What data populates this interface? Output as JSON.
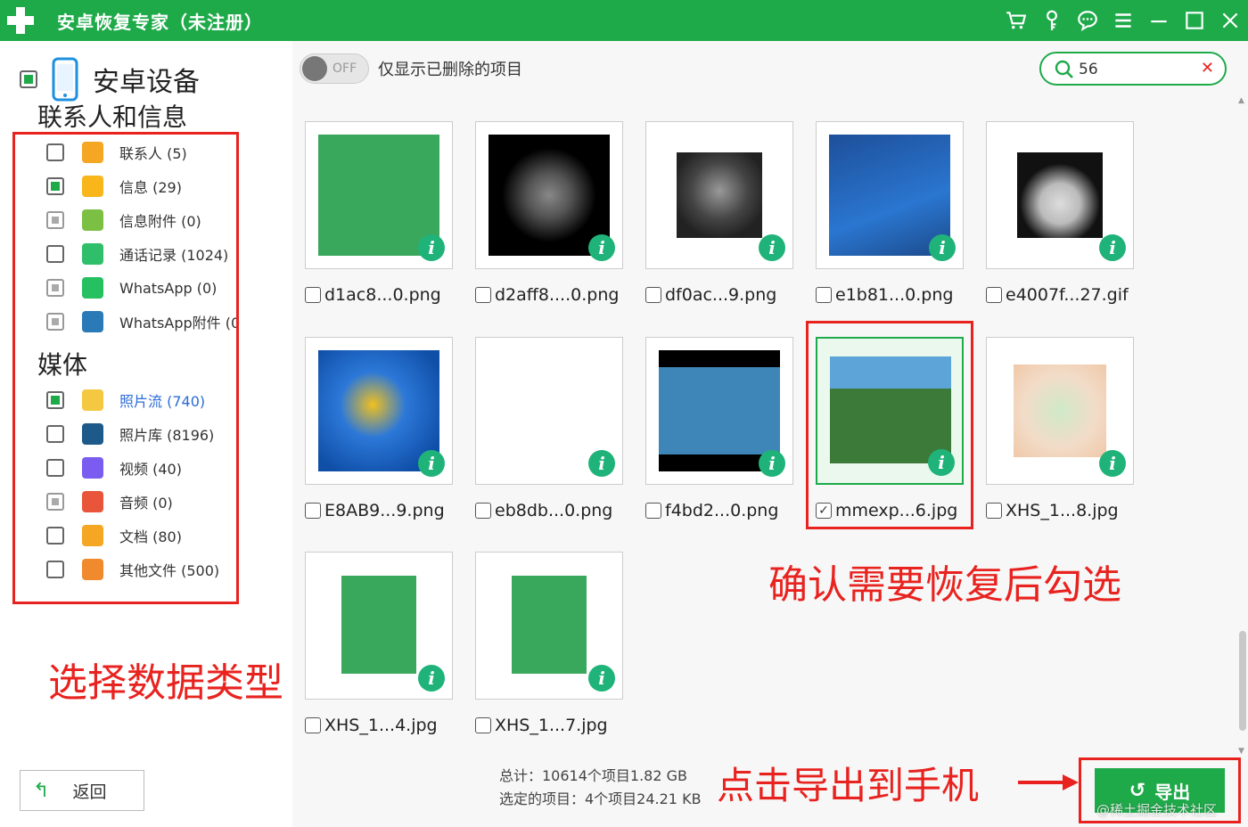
{
  "window": {
    "title": "安卓恢复专家（未注册）",
    "icons": [
      "cart-icon",
      "key-icon",
      "chat-icon",
      "menu-icon",
      "minimize-icon",
      "maximize-icon",
      "close-icon"
    ]
  },
  "sidebar": {
    "device_title": "安卓设备",
    "section_contacts": "联系人和信息",
    "section_media": "媒体",
    "contacts_items": [
      {
        "label": "联系人 (5)",
        "icon": "contact-icon",
        "color": "#f5a623",
        "state": "unchecked"
      },
      {
        "label": "信息 (29)",
        "icon": "message-icon",
        "color": "#f8b61b",
        "state": "checked"
      },
      {
        "label": "信息附件 (0)",
        "icon": "attachment-icon",
        "color": "#7bc043",
        "state": "partial"
      },
      {
        "label": "通话记录 (1024)",
        "icon": "phone-icon",
        "color": "#2fbf6a",
        "state": "unchecked"
      },
      {
        "label": "WhatsApp (0)",
        "icon": "whatsapp-icon",
        "color": "#25c160",
        "state": "partial"
      },
      {
        "label": "WhatsApp附件 (0",
        "icon": "whatsapp-attachment-icon",
        "color": "#2a7ab8",
        "state": "partial"
      }
    ],
    "media_items": [
      {
        "label": "照片流 (740)",
        "icon": "photostream-icon",
        "color": "#f5c842",
        "state": "checked",
        "active": true
      },
      {
        "label": "照片库 (8196)",
        "icon": "photo-library-icon",
        "color": "#1d5a8a",
        "state": "unchecked"
      },
      {
        "label": "视频 (40)",
        "icon": "video-icon",
        "color": "#7a5cf0",
        "state": "unchecked"
      },
      {
        "label": "音频 (0)",
        "icon": "audio-icon",
        "color": "#e8553b",
        "state": "partial"
      },
      {
        "label": "文档 (80)",
        "icon": "document-icon",
        "color": "#f5a623",
        "state": "unchecked"
      },
      {
        "label": "其他文件 (500)",
        "icon": "other-files-icon",
        "color": "#f08a2c",
        "state": "unchecked"
      }
    ],
    "back_label": "返回",
    "annotation": "选择数据类型"
  },
  "toolbar": {
    "toggle_text": "OFF",
    "only_deleted_label": "仅显示已删除的项目",
    "search_value": "56"
  },
  "files": [
    {
      "name": "d1ac8...0.png",
      "checked": false
    },
    {
      "name": "d2aff8....0.png",
      "checked": false
    },
    {
      "name": "df0ac...9.png",
      "checked": false
    },
    {
      "name": "e1b81...0.png",
      "checked": false
    },
    {
      "name": "e4007f...27.gif",
      "checked": false
    },
    {
      "name": "E8AB9...9.png",
      "checked": false
    },
    {
      "name": "eb8db...0.png",
      "checked": false
    },
    {
      "name": "f4bd2...0.png",
      "checked": false
    },
    {
      "name": "mmexp...6.jpg",
      "checked": true
    },
    {
      "name": "XHS_1...8.jpg",
      "checked": false
    },
    {
      "name": "XHS_1...4.jpg",
      "checked": false
    },
    {
      "name": "XHS_1...7.jpg",
      "checked": false
    }
  ],
  "annotations": {
    "confirm": "确认需要恢复后勾选",
    "export_hint": "点击导出到手机"
  },
  "summary": {
    "total": "总计：10614个项目1.82 GB",
    "selected": "选定的项目：4个项目24.21 KB"
  },
  "export_label": "导出",
  "watermark": "@稀土掘金技术社区",
  "colors": {
    "brand": "#1faa4a",
    "annotation": "#e8231f",
    "info": "#1fb37a"
  }
}
